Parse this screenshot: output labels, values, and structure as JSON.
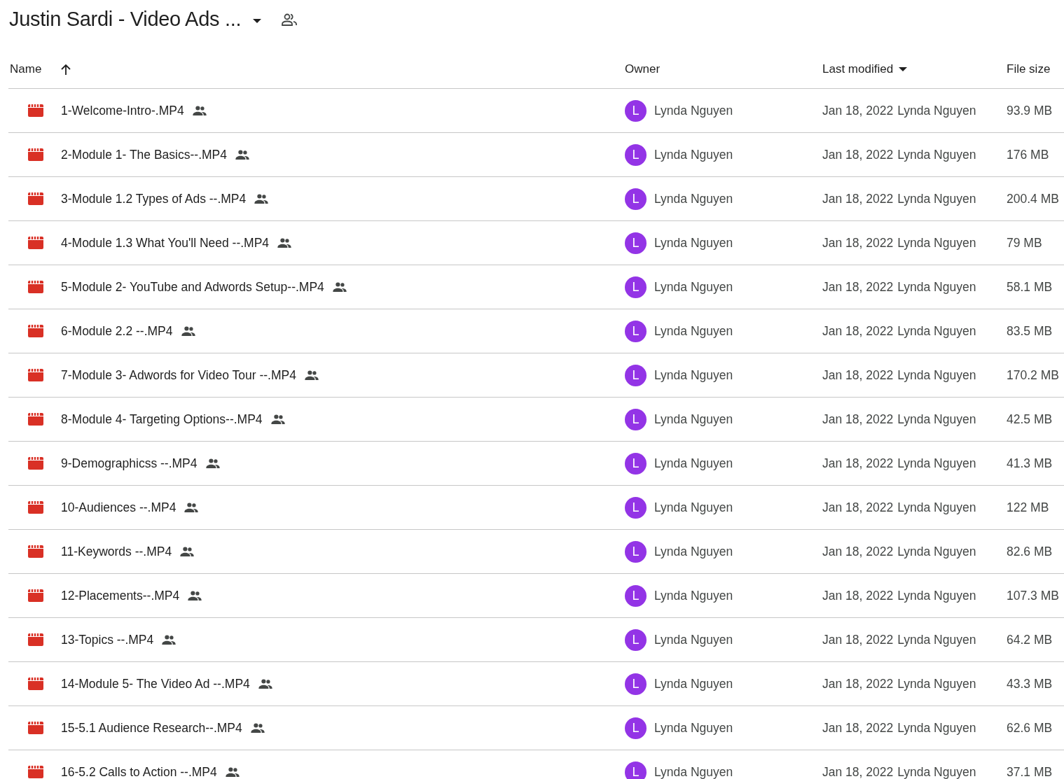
{
  "folder": {
    "title": "Justin Sardi - Video Ads ..."
  },
  "columns": [
    {
      "label": "Name"
    },
    {
      "label": "Owner"
    },
    {
      "label": "Last modified"
    },
    {
      "label": "File size"
    }
  ],
  "rows": [
    {
      "name": "1-Welcome-Intro-.MP4",
      "shared": true,
      "owner_initial": "L",
      "owner": "Lynda Nguyen",
      "modified": "Jan 18, 2022",
      "modified_by": "Lynda Nguyen",
      "size": "93.9 MB"
    },
    {
      "name": "2-Module 1- The Basics--.MP4",
      "shared": true,
      "owner_initial": "L",
      "owner": "Lynda Nguyen",
      "modified": "Jan 18, 2022",
      "modified_by": "Lynda Nguyen",
      "size": "176 MB"
    },
    {
      "name": "3-Module 1.2 Types of Ads --.MP4",
      "shared": true,
      "owner_initial": "L",
      "owner": "Lynda Nguyen",
      "modified": "Jan 18, 2022",
      "modified_by": "Lynda Nguyen",
      "size": "200.4 MB"
    },
    {
      "name": "4-Module 1.3 What You'll Need --.MP4",
      "shared": true,
      "owner_initial": "L",
      "owner": "Lynda Nguyen",
      "modified": "Jan 18, 2022",
      "modified_by": "Lynda Nguyen",
      "size": "79 MB"
    },
    {
      "name": "5-Module 2- YouTube and Adwords Setup--.MP4",
      "shared": true,
      "owner_initial": "L",
      "owner": "Lynda Nguyen",
      "modified": "Jan 18, 2022",
      "modified_by": "Lynda Nguyen",
      "size": "58.1 MB"
    },
    {
      "name": "6-Module 2.2 --.MP4",
      "shared": true,
      "owner_initial": "L",
      "owner": "Lynda Nguyen",
      "modified": "Jan 18, 2022",
      "modified_by": "Lynda Nguyen",
      "size": "83.5 MB"
    },
    {
      "name": "7-Module 3- Adwords for Video Tour --.MP4",
      "shared": true,
      "owner_initial": "L",
      "owner": "Lynda Nguyen",
      "modified": "Jan 18, 2022",
      "modified_by": "Lynda Nguyen",
      "size": "170.2 MB"
    },
    {
      "name": "8-Module 4- Targeting Options--.MP4",
      "shared": true,
      "owner_initial": "L",
      "owner": "Lynda Nguyen",
      "modified": "Jan 18, 2022",
      "modified_by": "Lynda Nguyen",
      "size": "42.5 MB"
    },
    {
      "name": "9-Demographicss --.MP4",
      "shared": true,
      "owner_initial": "L",
      "owner": "Lynda Nguyen",
      "modified": "Jan 18, 2022",
      "modified_by": "Lynda Nguyen",
      "size": "41.3 MB"
    },
    {
      "name": "10-Audiences --.MP4",
      "shared": true,
      "owner_initial": "L",
      "owner": "Lynda Nguyen",
      "modified": "Jan 18, 2022",
      "modified_by": "Lynda Nguyen",
      "size": "122 MB"
    },
    {
      "name": "11-Keywords --.MP4",
      "shared": true,
      "owner_initial": "L",
      "owner": "Lynda Nguyen",
      "modified": "Jan 18, 2022",
      "modified_by": "Lynda Nguyen",
      "size": "82.6 MB"
    },
    {
      "name": "12-Placements--.MP4",
      "shared": true,
      "owner_initial": "L",
      "owner": "Lynda Nguyen",
      "modified": "Jan 18, 2022",
      "modified_by": "Lynda Nguyen",
      "size": "107.3 MB"
    },
    {
      "name": "13-Topics --.MP4",
      "shared": true,
      "owner_initial": "L",
      "owner": "Lynda Nguyen",
      "modified": "Jan 18, 2022",
      "modified_by": "Lynda Nguyen",
      "size": "64.2 MB"
    },
    {
      "name": "14-Module 5- The Video Ad --.MP4",
      "shared": true,
      "owner_initial": "L",
      "owner": "Lynda Nguyen",
      "modified": "Jan 18, 2022",
      "modified_by": "Lynda Nguyen",
      "size": "43.3 MB"
    },
    {
      "name": "15-5.1 Audience Research--.MP4",
      "shared": true,
      "owner_initial": "L",
      "owner": "Lynda Nguyen",
      "modified": "Jan 18, 2022",
      "modified_by": "Lynda Nguyen",
      "size": "62.6 MB"
    },
    {
      "name": "16-5.2 Calls to Action --.MP4",
      "shared": true,
      "owner_initial": "L",
      "owner": "Lynda Nguyen",
      "modified": "Jan 18, 2022",
      "modified_by": "Lynda Nguyen",
      "size": "37.1 MB"
    }
  ]
}
